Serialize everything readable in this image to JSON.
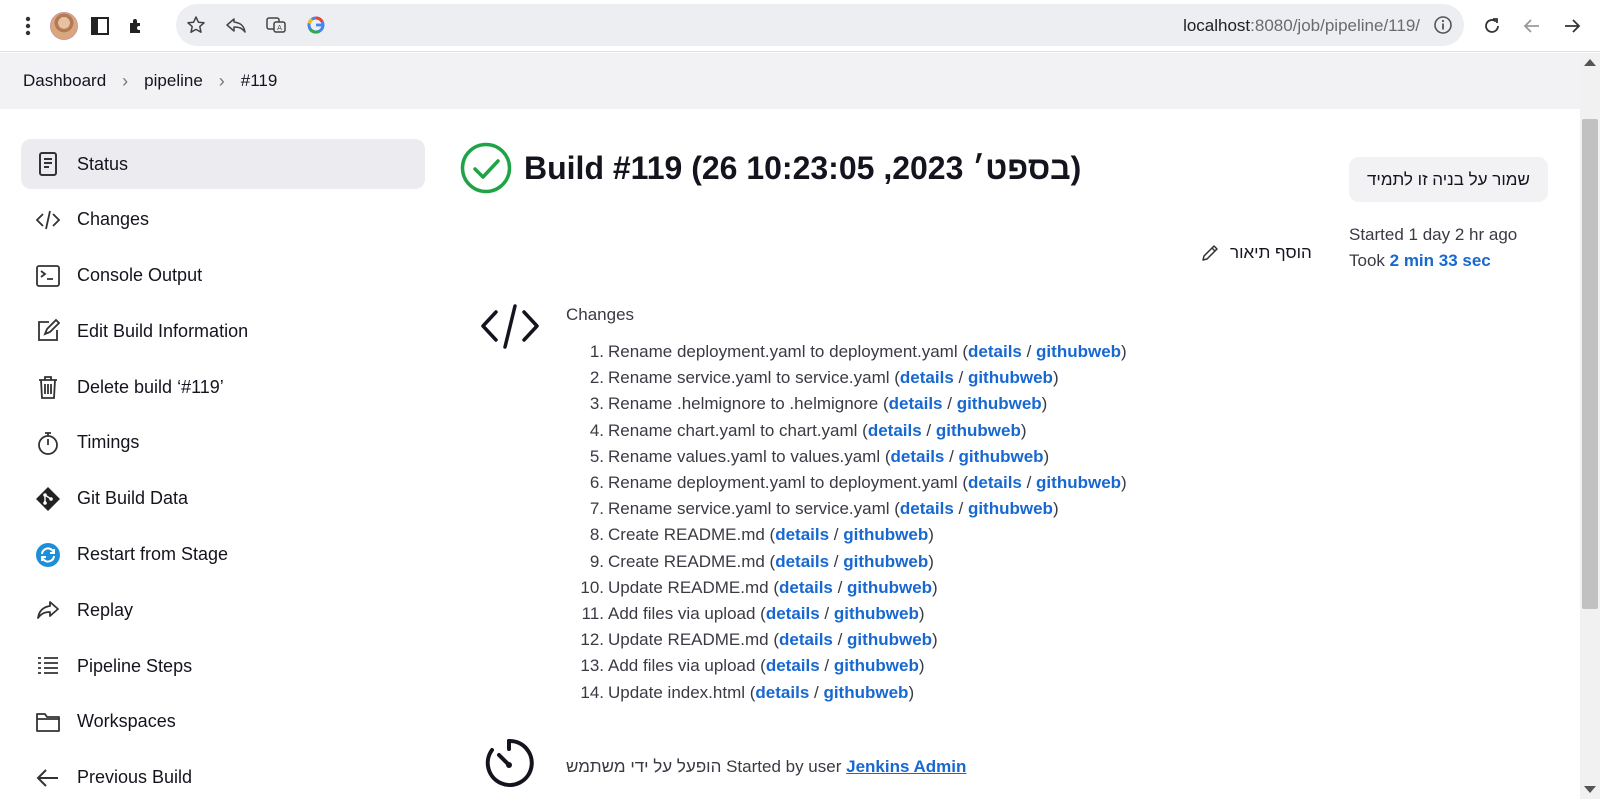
{
  "browser": {
    "url_host": "localhost",
    "url_rest": ":8080/job/pipeline/119/"
  },
  "breadcrumb": [
    "Dashboard",
    "pipeline",
    "#119"
  ],
  "sidebar": {
    "items": [
      {
        "label": "Status",
        "icon": "status-icon",
        "active": true
      },
      {
        "label": "Changes",
        "icon": "code-icon"
      },
      {
        "label": "Console Output",
        "icon": "terminal-icon"
      },
      {
        "label": "Edit Build Information",
        "icon": "edit-icon"
      },
      {
        "label": "Delete build ‘#119’",
        "icon": "trash-icon"
      },
      {
        "label": "Timings",
        "icon": "stopwatch-icon"
      },
      {
        "label": "Git Build Data",
        "icon": "git-icon"
      },
      {
        "label": "Restart from Stage",
        "icon": "restart-icon"
      },
      {
        "label": "Replay",
        "icon": "replay-icon"
      },
      {
        "label": "Pipeline Steps",
        "icon": "list-icon"
      },
      {
        "label": "Workspaces",
        "icon": "folder-icon"
      },
      {
        "label": "Previous Build",
        "icon": "arrow-left-icon"
      }
    ]
  },
  "build": {
    "title": "Build #119 (26 בספט׳ 2023, 10:23:05)",
    "keep_label": "שמור על בניה זו לתמיד",
    "started": "Started 1 day 2 hr ago",
    "took_prefix": "Took ",
    "took_value": "2 min 33 sec",
    "add_description": "הוסף תיאור",
    "status_color": "#1ea446"
  },
  "changes": {
    "heading": "Changes",
    "details_label": "details",
    "githubweb_label": "githubweb",
    "items": [
      "Rename deployment.yaml to deployment.yaml",
      "Rename service.yaml to service.yaml",
      "Rename .helmignore to .helmignore",
      "Rename chart.yaml to chart.yaml",
      "Rename values.yaml to values.yaml",
      "Rename deployment.yaml to deployment.yaml",
      "Rename service.yaml to service.yaml",
      "Create README.md",
      "Create README.md",
      "Update README.md",
      "Add files via upload",
      "Update README.md",
      "Add files via upload",
      "Update index.html"
    ]
  },
  "started_by": {
    "text": "הופעל על ידי משתמש Started by user ",
    "user": "Jenkins Admin"
  },
  "colors": {
    "link": "#1868d1",
    "success": "#1ea446"
  }
}
